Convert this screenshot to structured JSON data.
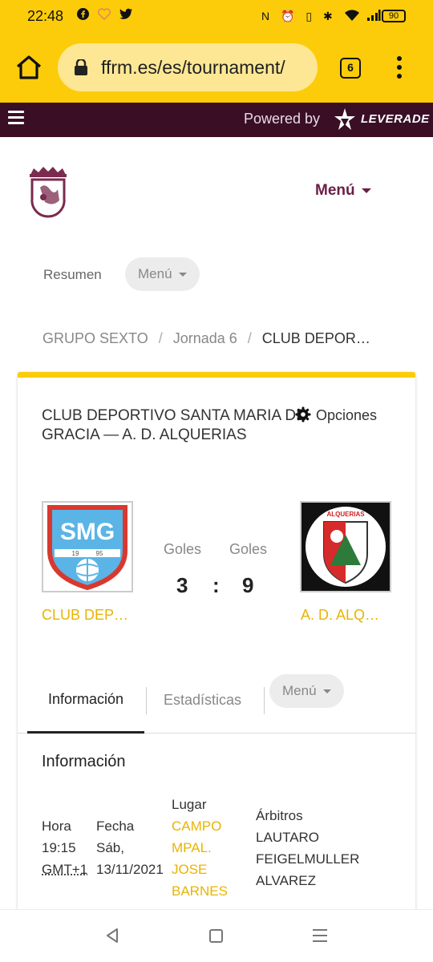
{
  "status_bar": {
    "time": "22:48",
    "battery": "90",
    "icons": [
      "facebook-icon",
      "heart-icon",
      "twitter-icon",
      "nfc-icon",
      "alarm-icon",
      "vibrate-icon",
      "bluetooth-icon",
      "wifi-icon",
      "signal-icon"
    ]
  },
  "browser": {
    "url": "ffrm.es/es/tournament/",
    "tab_count": "6"
  },
  "leverade_bar": {
    "powered_by": "Powered by",
    "brand": "LEVERADE"
  },
  "site_header": {
    "menu_label": "Menú"
  },
  "subnav": {
    "resumen": "Resumen",
    "menu": "Menú"
  },
  "breadcrumb": {
    "items": [
      "GRUPO SEXTO",
      "Jornada 6",
      "CLUB DEPOR…"
    ],
    "separator": "/"
  },
  "match": {
    "title": "CLUB DEPORTIVO SANTA MARIA DE GRACIA — A. D. ALQUERIAS",
    "options_label": "Opciones",
    "home": {
      "name": "CLUB DEP…",
      "logo_text": "SMG",
      "logo_year_left": "19",
      "logo_year_right": "95",
      "goals_label": "Goles",
      "goals": "3"
    },
    "away": {
      "name": "A. D. ALQ…",
      "logo_text": "ALQUERIAS",
      "goals_label": "Goles",
      "goals": "9"
    },
    "score_separator": ":"
  },
  "tabs": {
    "info": "Información",
    "stats": "Estadísticas",
    "menu": "Menú"
  },
  "info": {
    "heading": "Información",
    "hora_label": "Hora",
    "hora_value": "19:15",
    "timezone": "GMT+1",
    "fecha_label": "Fecha",
    "fecha_day": "Sáb,",
    "fecha_value": "13/11/2021",
    "lugar_label": "Lugar",
    "lugar_lines": [
      "CAMPO",
      "MPAL.",
      "JOSE",
      "BARNES"
    ],
    "arbitros_label": "Árbitros",
    "arbitros_lines": [
      "LAUTARO",
      "FEIGELMULLER",
      "ALVAREZ"
    ]
  },
  "colors": {
    "brand_yellow": "#fccc0a",
    "brand_maroon": "#3a0f26",
    "menu_maroon": "#6b1e45",
    "team_link_yellow": "#e8b400"
  }
}
